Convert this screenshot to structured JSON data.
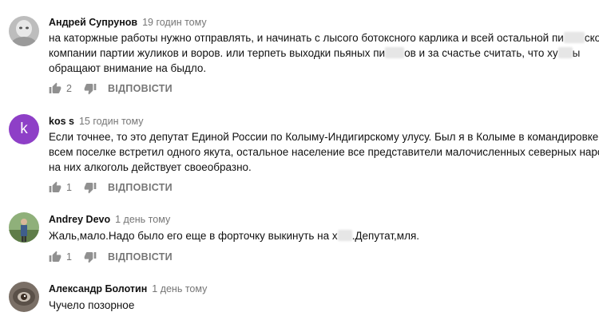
{
  "comments": [
    {
      "author": "Андрей Супрунов",
      "time": "19 годин тому",
      "lines": [
        [
          "на каторжные работы нужно отправлять, и начинать с лысого ботоксного карлика и всей остальной пи",
          "",
          "ской"
        ],
        [
          "компании партии жуликов и воров.  или терпеть выходки пьяных пи",
          "",
          "ов и за счастье считать, что ху",
          "",
          "ы"
        ],
        [
          "обращают  внимание на быдло."
        ]
      ],
      "likes": "2",
      "reply_label": "ВІДПОВІСТИ",
      "avatar": "photo"
    },
    {
      "author": "kos s",
      "time": "15 годин тому",
      "lines": [
        [
          "Если точнее, то это депутат Единой России по Колыму-Индигирскому улусу. Был я в Колыме в командировке, во"
        ],
        [
          "всем поселке встретил одного якута, остальное население все представители малочисленных северных народов,"
        ],
        [
          "на них алкоголь действует своеобразно."
        ]
      ],
      "likes": "1",
      "reply_label": "ВІДПОВІСТИ",
      "avatar": "letter",
      "avatar_letter": "k",
      "avatar_color": "#8e3fc7"
    },
    {
      "author": "Andrey Devo",
      "time": "1 день тому",
      "lines": [
        [
          "Жаль,мало.Надо было его еще в форточку выкинуть на х",
          "",
          ".Депутат,мля."
        ]
      ],
      "likes": "1",
      "reply_label": "ВІДПОВІСТИ",
      "avatar": "photo"
    },
    {
      "author": "Александр Болотин",
      "time": "1 день тому",
      "lines": [
        [
          "Чучело позорное"
        ]
      ],
      "avatar": "photo"
    }
  ],
  "icons": {
    "like": "thumb-up-icon",
    "dislike": "thumb-down-icon"
  }
}
